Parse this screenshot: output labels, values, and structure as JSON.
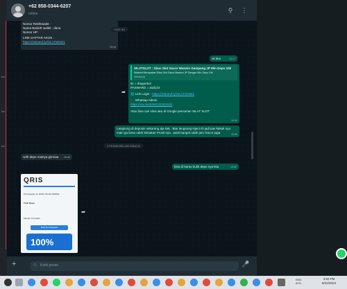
{
  "header": {
    "phone": "+62 858-0344-6207",
    "status": "online"
  },
  "messages": {
    "form_line1": "Nomor Rek/Ewalet :",
    "form_line2": "Nama Bank/E wallet : dana",
    "form_line3": "Nomor HP :",
    "form_link_label": "LINK DAFTAR AKUN :",
    "form_link": "https://rebrand.ly/SILATWIN01",
    "form_time": "15:16",
    "date_pill": "HARI INI",
    "ok_text": "ok kka",
    "ok_time": "15:17",
    "card_title": "SILATSLOT : Situs Slot Gacor Maxwin Gampang JP Min Depo 10k",
    "card_desc": "Silatslot Merupakan Situs Slot Gacor Maxwin JP Dengan Min Depo 10k",
    "card_domain": "rebrand.ly",
    "login_id": "ID = dragonbol",
    "login_pass": "PASWARD = asd123",
    "login_label": "🌐 Link Login :",
    "login_link": "https://rebrand.ly/SILATWIN01",
    "wa_label": "📞 Whatsap Admin",
    "wa_link": "https://wa.me/6282120324342",
    "google_text": "Atau bisa cari situs aku di Google pencarian SILAT SLOT",
    "google_time": "15:26",
    "inject_text": "Langsung di deposin sekarang aja kak , Biar langsung inject ID jadi pas kakak nya main ga lama udah kelaatan Provit nya , pasti banget udah jam Gacor juga",
    "inject_time": "15:26",
    "unread_pill": "1 PESAN BELUM DIBACA",
    "udh_text": "Udh depo mainya gimnaa",
    "udh_time": "15:46",
    "bisa_text": "bisa di bantu bukti depo nya kka",
    "bisa_time": "15:50"
  },
  "receipt": {
    "logo": "QRIS",
    "line1": "Pembayaran ke DANA SILAM SIMBIM",
    "line2": "Total Bayar",
    "line3": "Metode Transaksi",
    "button": "Bukti Pembayaran",
    "promo": "100%"
  },
  "footer": {
    "placeholder": "Ketik pesan"
  },
  "taskbar": {
    "lang1": "ENG",
    "lang2": "INTL",
    "time": "3:50 PM",
    "date": "5/22/2023"
  }
}
